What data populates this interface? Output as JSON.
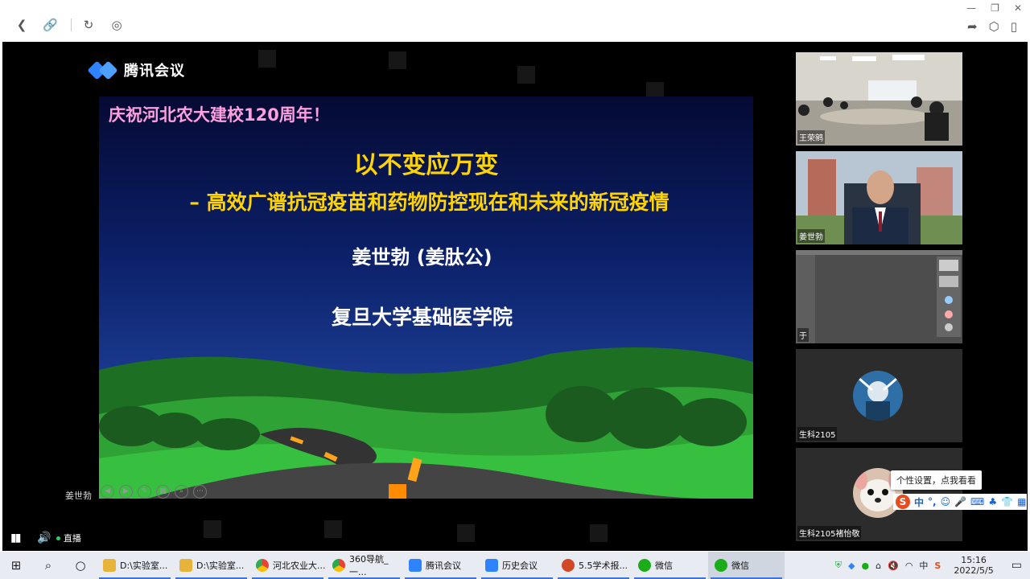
{
  "app": {
    "brand": "腾讯会议"
  },
  "slide": {
    "banner": "庆祝河北农大建校120周年！",
    "title": "以不变应万变",
    "subtitle": "– 高效广谱抗冠疫苗和药物防控现在和未来的新冠疫情",
    "speaker": "姜世勃 (姜肽公)",
    "affiliation": "复旦大学基础医学院"
  },
  "presenter_name": "姜世勃",
  "controls": {
    "live_label": "直播"
  },
  "participants": [
    {
      "name": "王荣鹓"
    },
    {
      "name": "姜世勃"
    },
    {
      "name": "于"
    },
    {
      "name": "生科2105"
    },
    {
      "name": "生科2105褚怡敬"
    }
  ],
  "tooltip": "个性设置，点我看看",
  "ime": {
    "mode": "中"
  },
  "taskbar": {
    "tasks": [
      {
        "label": "D:\\实验室...",
        "color": "#e8b33a"
      },
      {
        "label": "D:\\实验室...",
        "color": "#e8b33a"
      },
      {
        "label": "河北农业大...",
        "color": "#34a853"
      },
      {
        "label": "360导航_一...",
        "color": "#2aa84a"
      },
      {
        "label": "腾讯会议",
        "color": "#2f83ff"
      },
      {
        "label": "历史会议",
        "color": "#2f83ff"
      },
      {
        "label": "5.5学术报...",
        "color": "#d24726"
      },
      {
        "label": "微信",
        "color": "#1aad19"
      },
      {
        "label": "微信",
        "color": "#1aad19"
      }
    ],
    "tray_lang": "中",
    "time": "15:16",
    "date": "2022/5/5"
  }
}
